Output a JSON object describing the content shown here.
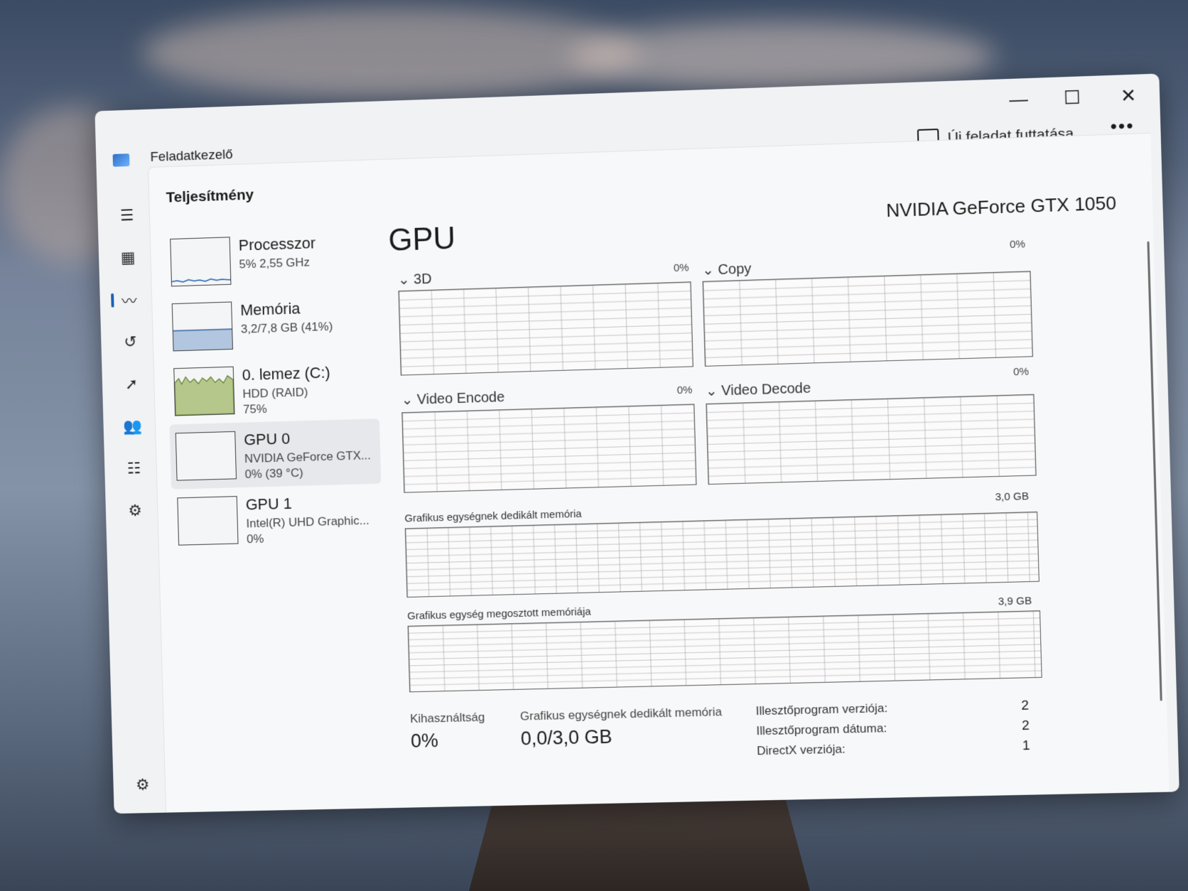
{
  "window": {
    "app_title": "Feladatkezelő",
    "minimize_glyph": "—",
    "maximize_glyph": "☐",
    "close_glyph": "✕",
    "new_task_label": "Új feladat futtatása",
    "more_glyph": "•••"
  },
  "nav": {
    "items": [
      {
        "icon": "hamburger-menu-icon",
        "glyph": "☰"
      },
      {
        "icon": "processes-icon",
        "glyph": "▦"
      },
      {
        "icon": "performance-icon",
        "glyph": "〰",
        "active": true
      },
      {
        "icon": "app-history-icon",
        "glyph": "↺"
      },
      {
        "icon": "startup-apps-icon",
        "glyph": "➚"
      },
      {
        "icon": "users-icon",
        "glyph": "👥"
      },
      {
        "icon": "details-icon",
        "glyph": "☷"
      },
      {
        "icon": "services-icon",
        "glyph": "⚙"
      }
    ],
    "settings_glyph": "⚙"
  },
  "page": {
    "title": "Teljesítmény"
  },
  "devices": [
    {
      "name": "Processzor",
      "sub1": "5% 2,55 GHz",
      "sub2": ""
    },
    {
      "name": "Memória",
      "sub1": "3,2/7,8 GB (41%)",
      "sub2": ""
    },
    {
      "name": "0. lemez (C:)",
      "sub1": "HDD (RAID)",
      "sub2": "75%"
    },
    {
      "name": "GPU 0",
      "sub1": "NVIDIA GeForce GTX...",
      "sub2": "0% (39 °C)",
      "selected": true
    },
    {
      "name": "GPU 1",
      "sub1": "Intel(R) UHD Graphic...",
      "sub2": "0%"
    }
  ],
  "gpu": {
    "title": "GPU",
    "model": "NVIDIA GeForce GTX 1050",
    "engines": [
      {
        "label": "3D",
        "value": "0%"
      },
      {
        "label": "Copy",
        "value": "0%"
      },
      {
        "label": "Video Encode",
        "value": "0%"
      },
      {
        "label": "Video Decode",
        "value": "0%"
      }
    ],
    "dedicated_memory_graph": {
      "label": "Grafikus egységnek dedikált memória",
      "max": "3,0 GB"
    },
    "shared_memory_graph": {
      "label": "Grafikus egység megosztott memóriája",
      "max": "3,9 GB"
    },
    "stats": {
      "utilization_label": "Kihasználtság",
      "utilization_value": "0%",
      "dedicated_label": "Grafikus egységnek dedikált memória",
      "dedicated_value": "0,0/3,0 GB"
    },
    "info": [
      {
        "label": "Illesztőprogram verziója:",
        "value": "2"
      },
      {
        "label": "Illesztőprogram dátuma:",
        "value": "2"
      },
      {
        "label": "DirectX verziója:",
        "value": "1"
      }
    ]
  }
}
